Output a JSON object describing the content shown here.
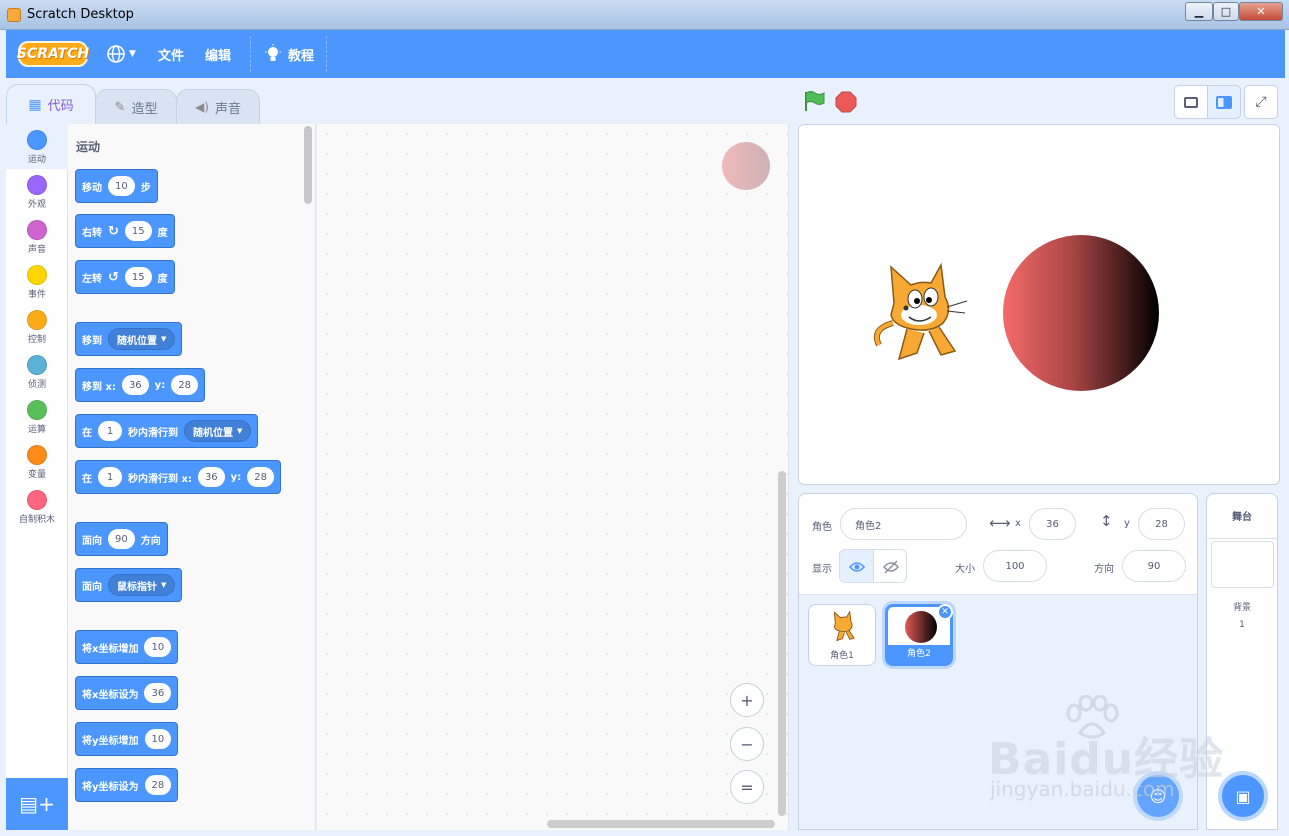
{
  "window": {
    "title": "Scratch Desktop",
    "controls": [
      "minimize-icon",
      "maximize-icon",
      "close-icon"
    ]
  },
  "menubar": {
    "logo": "SCRATCH",
    "file": "文件",
    "edit": "编辑",
    "tutorials": "教程",
    "language_icon": "globe-icon"
  },
  "tabs": [
    {
      "label": "代码",
      "icon": "code-icon",
      "active": true
    },
    {
      "label": "造型",
      "icon": "brush-icon"
    },
    {
      "label": "声音",
      "icon": "speaker-icon"
    }
  ],
  "categories": [
    {
      "label": "运动",
      "color": "#4c97ff"
    },
    {
      "label": "外观",
      "color": "#9966ff"
    },
    {
      "label": "声音",
      "color": "#cf63cf"
    },
    {
      "label": "事件",
      "color": "#ffd500"
    },
    {
      "label": "控制",
      "color": "#ffab19"
    },
    {
      "label": "侦测",
      "color": "#5cb1d6"
    },
    {
      "label": "运算",
      "color": "#59c059"
    },
    {
      "label": "变量",
      "color": "#ff8c1a"
    },
    {
      "label": "自制积木",
      "color": "#ff6680"
    }
  ],
  "palette": {
    "heading": "运动",
    "blocks": {
      "move": {
        "t1": "移动",
        "v1": "10",
        "t2": "步"
      },
      "turn_right": {
        "t1": "右转",
        "v1": "15",
        "t2": "度"
      },
      "turn_left": {
        "t1": "左转",
        "v1": "15",
        "t2": "度"
      },
      "goto": {
        "t1": "移到",
        "d1": "随机位置"
      },
      "goto_xy": {
        "t1": "移到 x:",
        "v1": "36",
        "t2": "y:",
        "v2": "28"
      },
      "glide": {
        "t1": "在",
        "v1": "1",
        "t2": "秒内滑行到",
        "d1": "随机位置"
      },
      "glide_xy": {
        "t1": "在",
        "v1": "1",
        "t2": "秒内滑行到 x:",
        "v2": "36",
        "t3": "y:",
        "v3": "28"
      },
      "point_dir": {
        "t1": "面向",
        "v1": "90",
        "t2": "方向"
      },
      "point_towards": {
        "t1": "面向",
        "d1": "鼠标指针"
      },
      "change_x": {
        "t1": "将x坐标增加",
        "v1": "10"
      },
      "set_x": {
        "t1": "将x坐标设为",
        "v1": "36"
      },
      "change_y": {
        "t1": "将y坐标增加",
        "v1": "10"
      },
      "set_y": {
        "t1": "将y坐标设为",
        "v1": "28"
      }
    }
  },
  "workspace": {
    "zoom_in": "+",
    "zoom_out": "−",
    "reset": "="
  },
  "sprite_info": {
    "sprite_label": "角色",
    "sprite_name": "角色2",
    "x_label": "x",
    "x_value": "36",
    "y_label": "y",
    "y_value": "28",
    "show_label": "显示",
    "size_label": "大小",
    "size_value": "100",
    "direction_label": "方向",
    "direction_value": "90"
  },
  "sprites": [
    {
      "name": "角色1"
    },
    {
      "name": "角色2",
      "selected": true
    }
  ],
  "stage_pane": {
    "title": "舞台",
    "backdrops_label": "背景",
    "backdrops_count": "1"
  },
  "watermark": {
    "big": "Baidu经验",
    "small": "jingyan.baidu.com"
  },
  "colors": {
    "accent": "#4c97ff",
    "motion": "#4c97ff",
    "flag": "#4cbf56",
    "stop": "#ec5959"
  }
}
